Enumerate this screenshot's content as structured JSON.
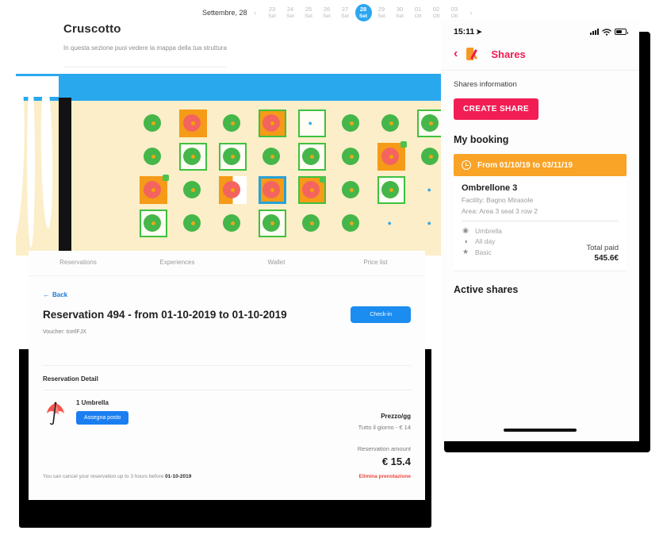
{
  "desktop": {
    "title": "Cruscotto",
    "subtitle": "In questa sezione puoi vedere la mappa della tua struttura",
    "calendar": {
      "month_label": "Settembre, 28",
      "prev_icon": "chevron-left-icon",
      "next_icon": "chevron-right-icon",
      "selected_index": 5,
      "days": [
        {
          "d": "23",
          "m": "Set"
        },
        {
          "d": "24",
          "m": "Set"
        },
        {
          "d": "25",
          "m": "Set"
        },
        {
          "d": "26",
          "m": "Set"
        },
        {
          "d": "27",
          "m": "Set"
        },
        {
          "d": "28",
          "m": "Set"
        },
        {
          "d": "29",
          "m": "Set"
        },
        {
          "d": "30",
          "m": "Set"
        },
        {
          "d": "01",
          "m": "Ott"
        },
        {
          "d": "02",
          "m": "Ott"
        },
        {
          "d": "03",
          "m": "Ott"
        }
      ]
    },
    "map": {
      "free_color": "#45b649",
      "busy_color": "#f4645f",
      "selected_fill": "#f59b18",
      "sand_color": "#fbeec8",
      "banner_color": "#29a8ee",
      "rows": [
        [
          {
            "state": "free"
          },
          {
            "state": "busy-fill"
          },
          {
            "state": "free"
          },
          {
            "state": "busy-fill-outlined"
          },
          {
            "state": "empty-box"
          },
          {
            "state": "free"
          },
          {
            "state": "free"
          },
          {
            "state": "free-box"
          }
        ],
        [
          {
            "state": "free"
          },
          {
            "state": "free-box"
          },
          {
            "state": "free-box"
          },
          {
            "state": "free"
          },
          {
            "state": "free-box"
          },
          {
            "state": "free"
          },
          {
            "state": "busy-fill-badge"
          },
          {
            "state": "free"
          }
        ],
        [
          {
            "state": "busy-fill-badge"
          },
          {
            "state": "free"
          },
          {
            "state": "half"
          },
          {
            "state": "busy-fill-blue"
          },
          {
            "state": "busy-fill-badge-outlined"
          },
          {
            "state": "free"
          },
          {
            "state": "free-box"
          },
          {
            "state": "pin"
          }
        ],
        [
          {
            "state": "free-box"
          },
          {
            "state": "free"
          },
          {
            "state": "free"
          },
          {
            "state": "free-box"
          },
          {
            "state": "free"
          },
          {
            "state": "free"
          },
          {
            "state": "pin"
          },
          {
            "state": "pin"
          }
        ]
      ]
    }
  },
  "reservation": {
    "tabs": [
      {
        "label": "Reservations"
      },
      {
        "label": "Experiences"
      },
      {
        "label": "Wallet"
      },
      {
        "label": "Price list"
      }
    ],
    "back_label": "Back",
    "back_icon": "arrow-left-icon",
    "title": "Reservation 494 - from 01-10-2019 to 01-10-2019",
    "checkin_label": "Check-in",
    "voucher": "Voucher: tceIlFJX",
    "detail_heading": "Reservation Detail",
    "item": {
      "icon": "closed-umbrella-icon",
      "label": "1 Umbrella",
      "assign_label": "Assegna posto"
    },
    "price_heading": "Prezzo/gg",
    "price_line": "Tutto il giorno - € 14",
    "amount_heading": "Reservation amount",
    "amount_value": "€ 15.4",
    "cancel_note_prefix": "You can cancel your reservation up to 3 hours before ",
    "cancel_note_date": "01-10-2019",
    "delete_label": "Elimina prenotazione",
    "accent_blue": "#1b8cf0",
    "danger_red": "#f0453a"
  },
  "phone": {
    "status": {
      "time": "15:11",
      "location_icon": "location-arrow-icon",
      "signal_icon": "cellular-bars-icon",
      "wifi_icon": "wifi-icon",
      "battery_icon": "battery-icon"
    },
    "nav": {
      "back_icon": "chevron-left-icon",
      "logo_icon": "bx-logo-icon",
      "title": "Shares"
    },
    "info_label": "Shares information",
    "create_label": "CREATE SHARE",
    "my_booking_heading": "My booking",
    "booking": {
      "date_icon": "clock-icon",
      "date_range": "From 01/10/19 to 03/11/19",
      "name": "Ombrellone 3",
      "facility": "Facility: Bagno Mirasole",
      "area": "Area: Area 3 seat 3 row 2",
      "features": [
        {
          "icon": "map-pin-icon",
          "glyph": "◉",
          "label": "Umbrella"
        },
        {
          "icon": "all-day-icon",
          "glyph": "◑",
          "label": "All day"
        },
        {
          "icon": "star-icon",
          "glyph": "★",
          "label": "Basic"
        }
      ],
      "total_label": "Total paid",
      "total_value": "545.6€"
    },
    "active_shares_heading": "Active shares",
    "brand_pink": "#ef1b52",
    "banner_orange": "#f9a327"
  }
}
